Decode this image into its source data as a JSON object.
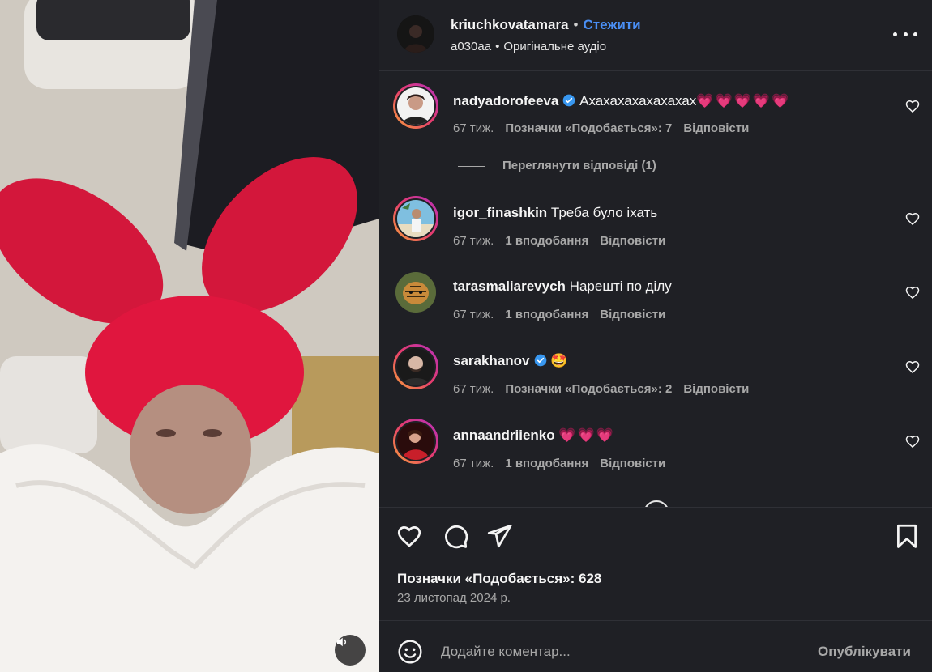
{
  "post": {
    "author": "kriuchkovatamara",
    "follow_label": "Стежити",
    "separator": "•",
    "audio_owner": "a030aa",
    "audio_label": "Оригінальне аудіо"
  },
  "media": {
    "mute_icon": "speaker-icon",
    "colors": {
      "hat": "#e0163e",
      "fur": "#f4f2ef"
    }
  },
  "comments": [
    {
      "user": "nadyadorofeeva",
      "verified": true,
      "text": "Ахахахахахахахах",
      "hearts": "💗💗💗💗💗",
      "time": "67 тиж.",
      "likes": "Позначки «Подобається»: 7",
      "reply": "Відповісти"
    },
    {
      "user": "igor_finashkin",
      "verified": false,
      "text": "Треба було іхать",
      "hearts": "",
      "time": "67 тиж.",
      "likes": "1 вподобання",
      "reply": "Відповісти"
    },
    {
      "user": "tarasmaliarevych",
      "verified": false,
      "text": "Нарешті по ділу",
      "hearts": "",
      "time": "67 тиж.",
      "likes": "1 вподобання",
      "reply": "Відповісти"
    },
    {
      "user": "sarakhanov",
      "verified": true,
      "text": "🤩",
      "hearts": "",
      "time": "67 тиж.",
      "likes": "Позначки «Подобається»: 2",
      "reply": "Відповісти"
    },
    {
      "user": "annaandriienko",
      "verified": false,
      "text": "",
      "hearts": "💗💗💗",
      "time": "67 тиж.",
      "likes": "1 вподобання",
      "reply": "Відповісти"
    }
  ],
  "view_replies": "Переглянути відповіді (1)",
  "actions": {
    "likes_count": "Позначки «Подобається»: 628",
    "date": "23 листопад 2024 р."
  },
  "add_comment": {
    "placeholder": "Додайте коментар...",
    "publish_label": "Опублікувати"
  },
  "colors": {
    "accent": "#4a8ff5",
    "heart": "#f2305f",
    "verified": "#3897f0",
    "panel_bg": "#1f2025"
  }
}
